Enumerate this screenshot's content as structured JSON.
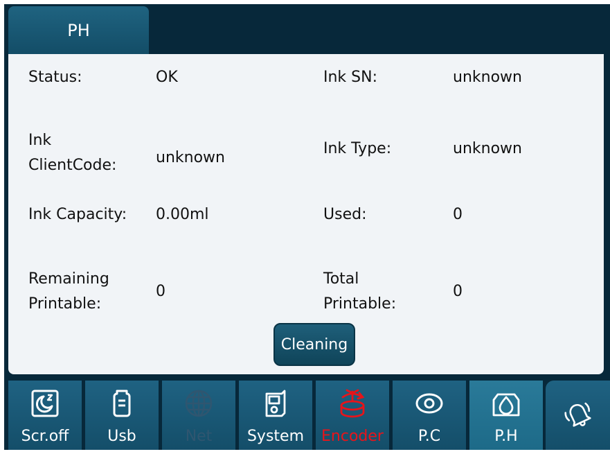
{
  "tab": {
    "label": "PH"
  },
  "fields": {
    "status": {
      "label": "Status:",
      "value": "OK"
    },
    "ink_sn": {
      "label": "Ink SN:",
      "value": "unknown"
    },
    "ink_clientcode": {
      "label_line1": "Ink",
      "label_line2": "ClientCode:",
      "value": "unknown"
    },
    "ink_type": {
      "label": "Ink Type:",
      "value": "unknown"
    },
    "ink_capacity": {
      "label": "Ink Capacity:",
      "value": "0.00ml"
    },
    "used": {
      "label": "Used:",
      "value": "0"
    },
    "remaining_printable": {
      "label_line1": "Remaining",
      "label_line2": "Printable:",
      "value": "0"
    },
    "total_printable": {
      "label_line1": "Total",
      "label_line2": "Printable:",
      "value": "0"
    }
  },
  "buttons": {
    "cleaning": "Cleaning"
  },
  "nav": [
    {
      "label": "Scr.off",
      "icon": "screen-off-moon-icon"
    },
    {
      "label": "Usb",
      "icon": "usb-drive-icon"
    },
    {
      "label": "Net",
      "icon": "globe-icon",
      "state": "disabled"
    },
    {
      "label": "System",
      "icon": "printer-system-icon"
    },
    {
      "label": "Encoder",
      "icon": "encoder-icon",
      "state": "alert"
    },
    {
      "label": "P.C",
      "icon": "eye-icon"
    },
    {
      "label": "P.H",
      "icon": "ink-drop-icon",
      "state": "selected"
    }
  ],
  "bell_icon": "bell-icon",
  "colors": {
    "frame": "#07283a",
    "panel": "#f1f4f7",
    "button": "#1a5a76",
    "alert_text": "#e8141a",
    "disabled_text": "#2f5670"
  }
}
